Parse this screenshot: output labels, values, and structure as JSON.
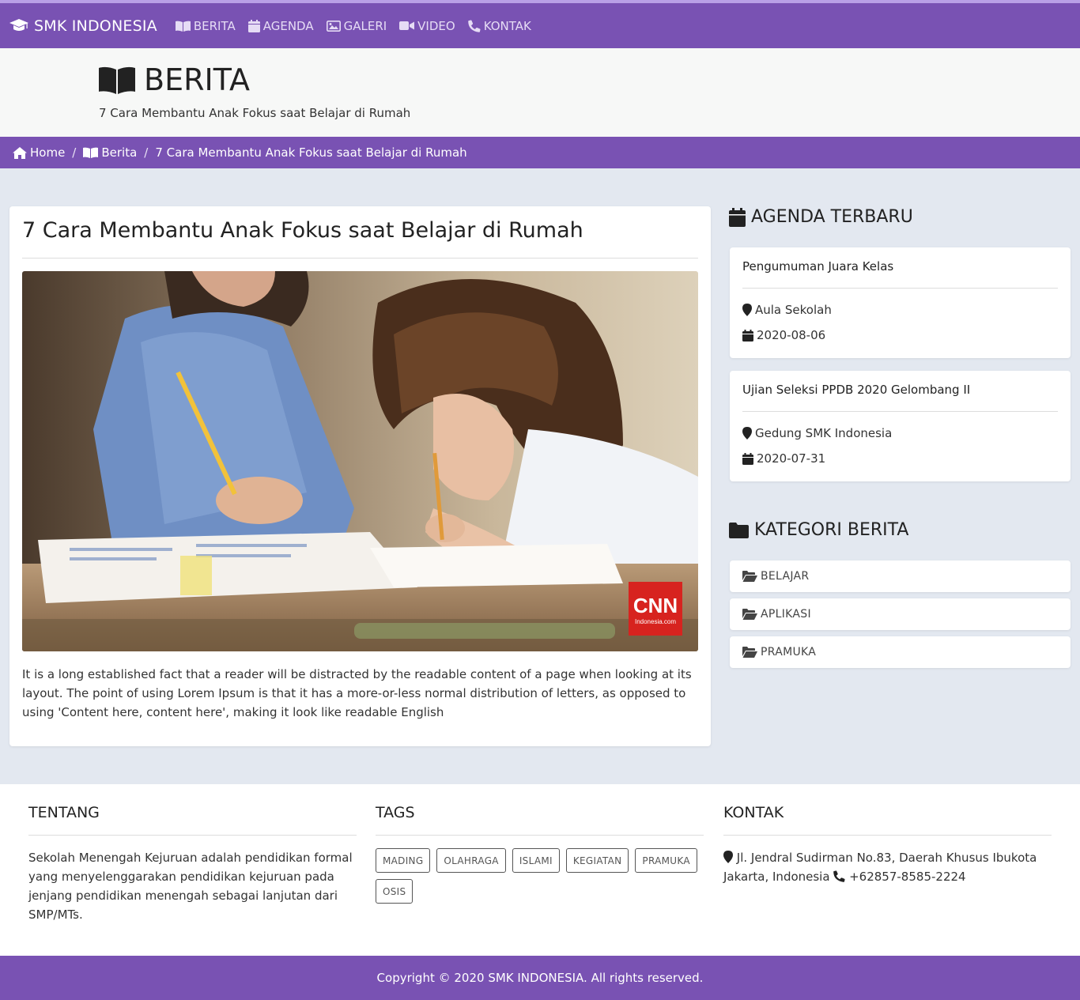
{
  "nav": {
    "brand": "SMK INDONESIA",
    "items": [
      {
        "label": "BERITA",
        "icon": "book-open-icon"
      },
      {
        "label": "AGENDA",
        "icon": "calendar-icon"
      },
      {
        "label": "GALERI",
        "icon": "image-icon"
      },
      {
        "label": "VIDEO",
        "icon": "video-camera-icon"
      },
      {
        "label": "KONTAK",
        "icon": "phone-icon"
      }
    ]
  },
  "header": {
    "title": "BERITA",
    "subtitle": "7 Cara Membantu Anak Fokus saat Belajar di Rumah"
  },
  "breadcrumb": {
    "home": "Home",
    "section": "Berita",
    "current": "7 Cara Membantu Anak Fokus saat Belajar di Rumah"
  },
  "article": {
    "title": "7 Cara Membantu Anak Fokus saat Belajar di Rumah",
    "body": "It is a long established fact that a reader will be distracted by the readable content of a page when looking at its layout. The point of using Lorem Ipsum is that it has a more-or-less normal distribution of letters, as opposed to using 'Content here, content here', making it look like readable English",
    "image_watermark": {
      "brand": "CNN",
      "sub": "Indonesia.com"
    }
  },
  "sidebar": {
    "agenda_heading": "AGENDA TERBARU",
    "agenda": [
      {
        "title": "Pengumuman Juara Kelas",
        "location": "Aula Sekolah",
        "date": "2020-08-06"
      },
      {
        "title": "Ujian Seleksi PPDB 2020 Gelombang II",
        "location": "Gedung SMK Indonesia",
        "date": "2020-07-31"
      }
    ],
    "kategori_heading": "KATEGORI BERITA",
    "kategori": [
      "BELAJAR",
      "APLIKASI",
      "PRAMUKA"
    ]
  },
  "footer": {
    "tentang_heading": "TENTANG",
    "tentang_text": "Sekolah Menengah Kejuruan adalah pendidikan formal yang menyelenggarakan pendidikan kejuruan pada jenjang pendidikan menengah sebagai lanjutan dari SMP/MTs.",
    "tags_heading": "TAGS",
    "tags": [
      "MADING",
      "OLAHRAGA",
      "ISLAMI",
      "KEGIATAN",
      "PRAMUKA",
      "OSIS"
    ],
    "kontak_heading": "KONTAK",
    "address": "Jl. Jendral Sudirman No.83, Daerah Khusus Ibukota Jakarta, Indonesia",
    "phone": "+62857-8585-2224"
  },
  "copyright": "Copyright © 2020 SMK INDONESIA. All rights reserved.",
  "colors": {
    "primary": "#7952b3",
    "background": "#e3e8f0",
    "header_bg": "#f7f8f7"
  }
}
